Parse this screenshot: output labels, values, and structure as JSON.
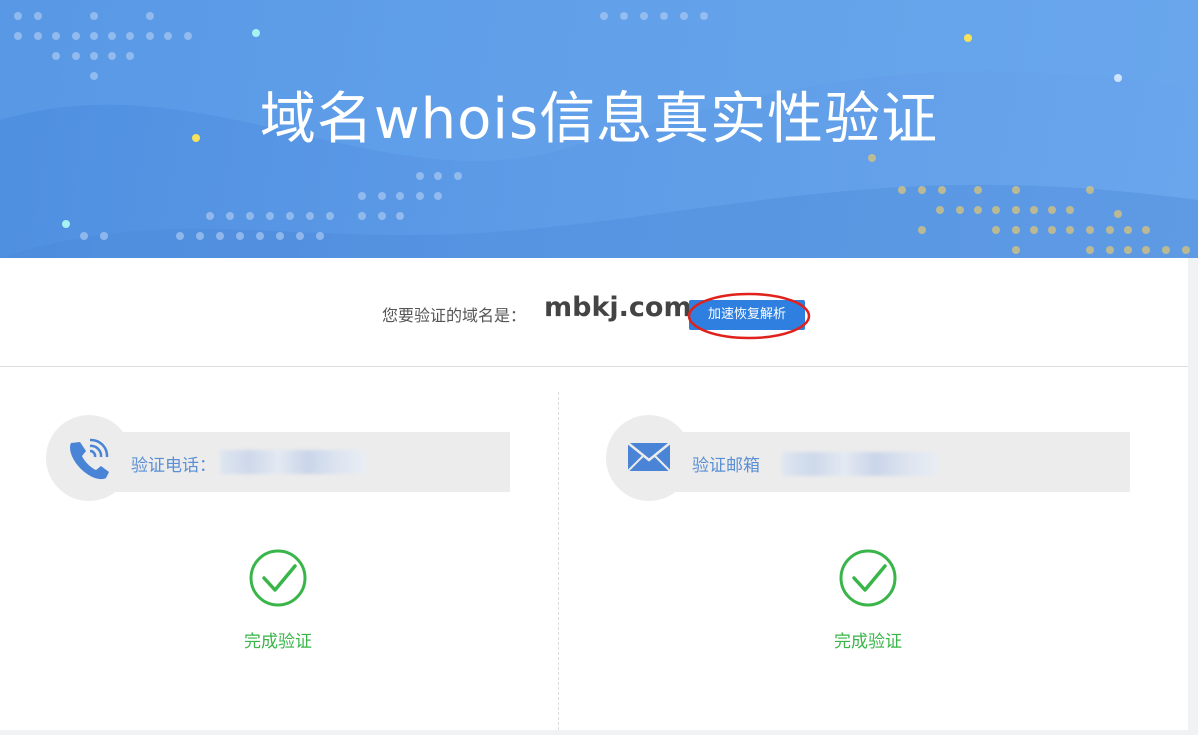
{
  "banner": {
    "title": "域名whois信息真实性验证"
  },
  "domain": {
    "label": "您要验证的域名是：",
    "name": "mbkj.com",
    "accelerate_button": "加速恢复解析"
  },
  "phone": {
    "icon": "phone-icon",
    "label": "验证电话：",
    "status": "完成验证"
  },
  "email": {
    "icon": "envelope-icon",
    "label": "验证邮箱",
    "status": "完成验证"
  },
  "colors": {
    "banner": "#5d9be7",
    "button": "#2f7fe0",
    "success": "#3ab54a",
    "label": "#5a8fd4",
    "highlight": "#e0221c"
  }
}
